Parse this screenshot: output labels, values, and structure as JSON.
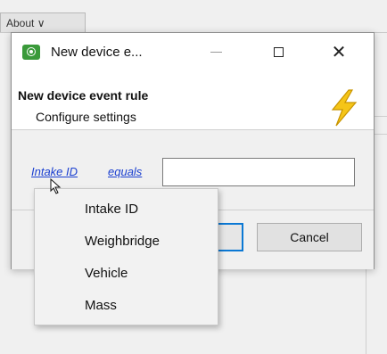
{
  "background": {
    "tab_label": "About ∨"
  },
  "dialog": {
    "title": "New device e...",
    "header_title": "New device event rule",
    "header_subtitle": "Configure settings",
    "rule": {
      "field_link": "Intake ID",
      "operator_link": "equals",
      "value": ""
    },
    "buttons": {
      "ok_label": "",
      "cancel_label": "Cancel"
    }
  },
  "dropdown": {
    "items": [
      "Intake ID",
      "Weighbridge",
      "Vehicle",
      "Mass"
    ]
  },
  "icons": {
    "app": "device-app-icon",
    "header": "lightning-bolt-icon"
  },
  "colors": {
    "link": "#1a3fd0",
    "focus_border": "#0b78d4",
    "bolt": "#f5c518",
    "app_icon": "#3a9a3a"
  }
}
